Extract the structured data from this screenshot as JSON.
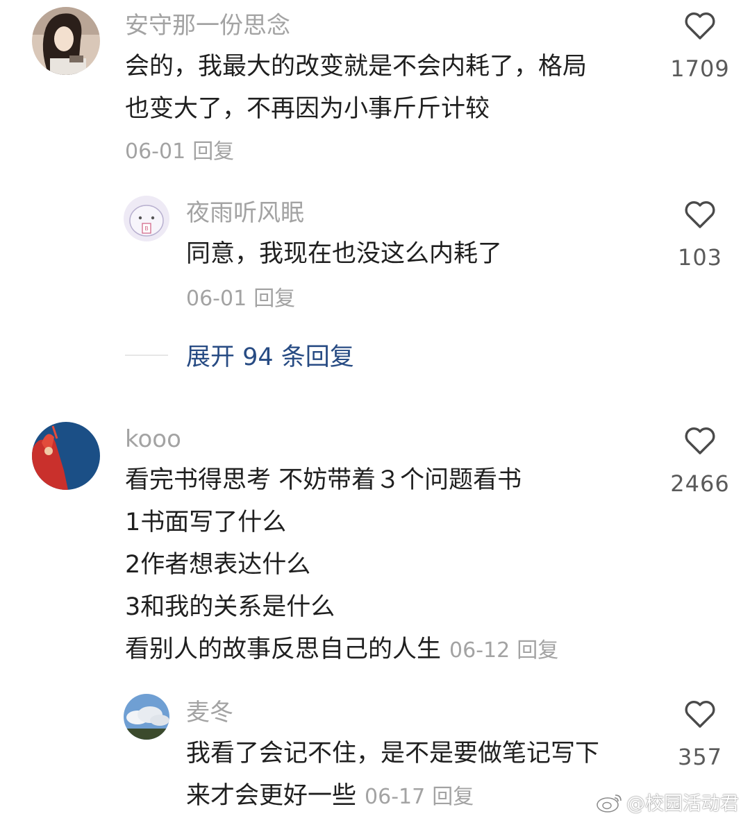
{
  "comments": [
    {
      "username": "安守那一份思念",
      "lines": [
        "会的，我最大的改变就是不会内耗了，格局",
        "也变大了，不再因为小事斤斤计较"
      ],
      "date": "06-01",
      "reply_label": "回复",
      "likes": "1709",
      "replies": [
        {
          "username": "夜雨听风眠",
          "lines": [
            "同意，我现在也没这么内耗了"
          ],
          "date": "06-01",
          "reply_label": "回复",
          "likes": "103"
        }
      ],
      "expand_label": "展开 94 条回复"
    },
    {
      "username": "kooo",
      "lines": [
        "看完书得思考 不妨带着３个问题看书",
        "1书面写了什么",
        "2作者想表达什么",
        "3和我的关系是什么",
        "看别人的故事反思自己的人生"
      ],
      "date": "06-12",
      "reply_label": "回复",
      "likes": "2466",
      "replies": [
        {
          "username": "麦冬",
          "lines": [
            "我看了会记不住，是不是要做笔记写下",
            "来才会更好一些"
          ],
          "date": "06-17",
          "reply_label": "回复",
          "likes": "357"
        }
      ]
    }
  ],
  "watermark": "@校园活动君",
  "icons": {
    "like": "heart-outline-icon",
    "watermark": "weibo-logo-icon"
  },
  "colors": {
    "text": "#1f1f1f",
    "muted": "#a3a3a3",
    "link": "#274b83"
  }
}
